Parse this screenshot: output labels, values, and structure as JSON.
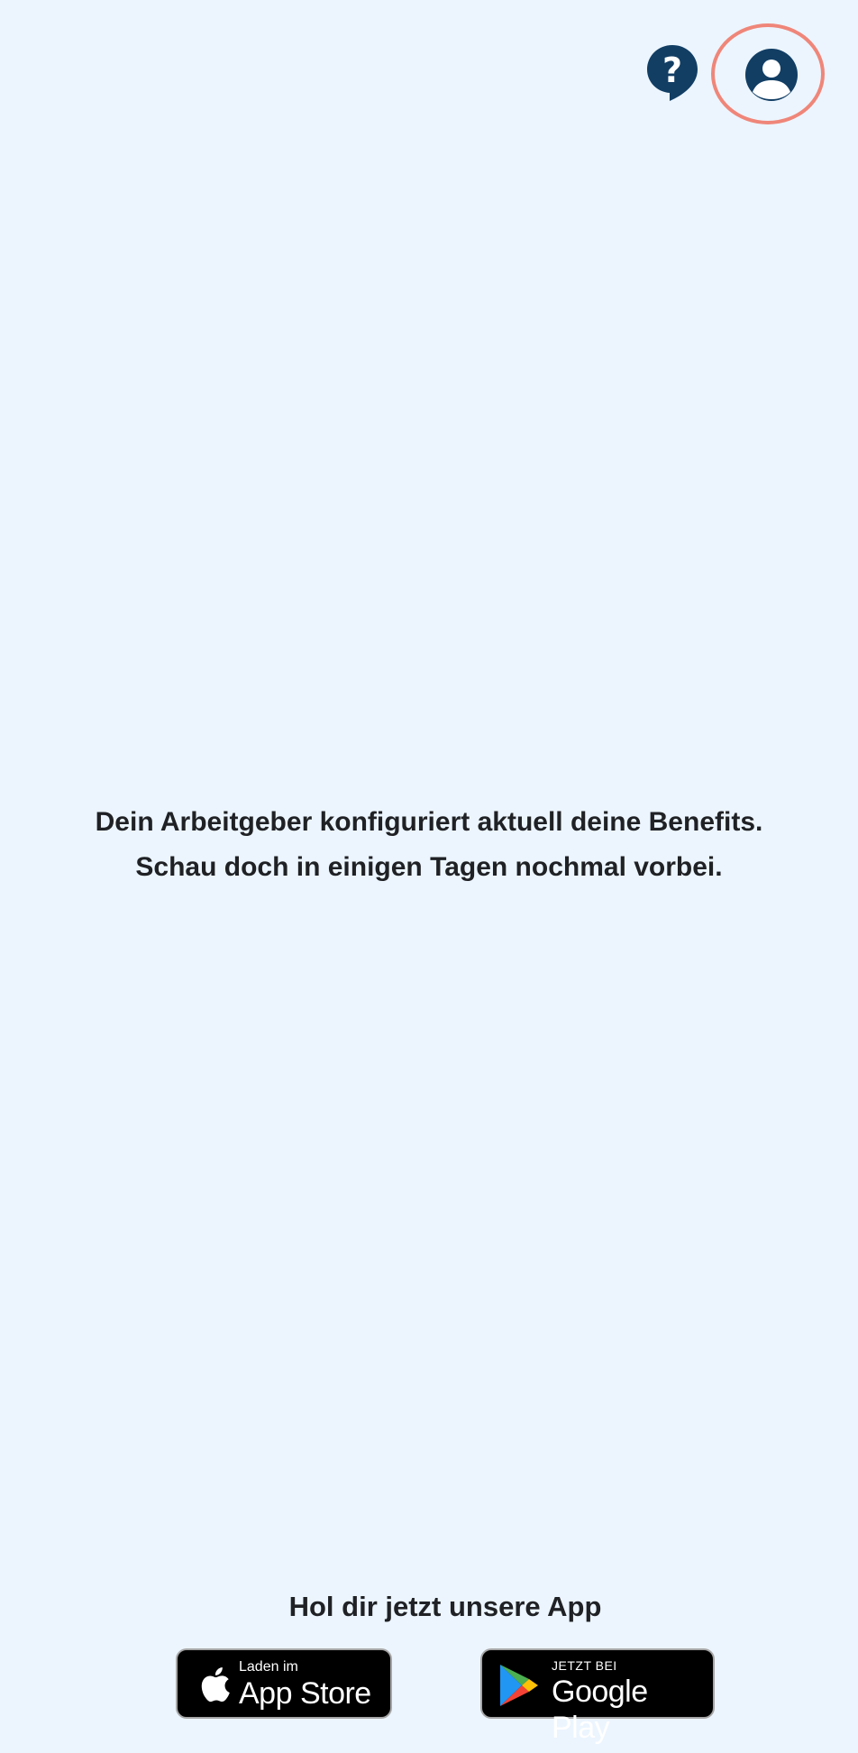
{
  "colors": {
    "background": "#ecf5fe",
    "icon_primary": "#123e64",
    "highlight_ring": "#ef8679",
    "text": "#1f2124",
    "badge_background": "#000000"
  },
  "header": {
    "help_icon": "help-bubble-icon",
    "profile_icon": "account-circle-icon"
  },
  "main": {
    "message_line1": "Dein Arbeitgeber konfiguriert aktuell deine Benefits.",
    "message_line2": "Schau doch in einigen Tagen nochmal vorbei."
  },
  "app_promo": {
    "title": "Hol dir jetzt unsere App",
    "appstore": {
      "small": "Laden im",
      "large": "App Store",
      "icon": "apple-logo-icon"
    },
    "googleplay": {
      "small": "JETZT BEI",
      "large": "Google Play",
      "icon": "google-play-logo-icon"
    }
  }
}
